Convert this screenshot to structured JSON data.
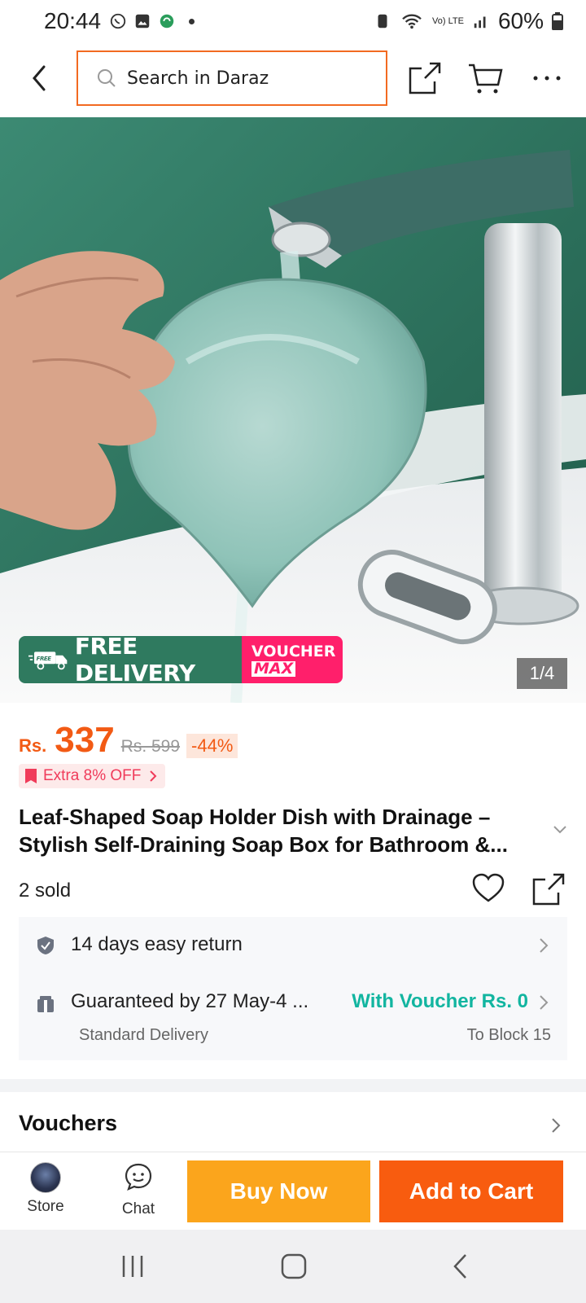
{
  "status_bar": {
    "time": "20:44",
    "battery": "60%",
    "network": "Vo) LTE"
  },
  "top_bar": {
    "search_placeholder": "Search in Daraz"
  },
  "gallery": {
    "pager": "1/4",
    "badge_free_delivery": "FREE DELIVERY",
    "badge_free_tag": "FREE",
    "badge_voucher": "VOUCHER",
    "badge_max": "MAX"
  },
  "product": {
    "currency": "Rs.",
    "price": "337",
    "original_price": "Rs. 599",
    "discount": "-44%",
    "extra_offer": "Extra 8% OFF",
    "title": "Leaf-Shaped Soap Holder Dish with Drainage – Stylish Self-Draining Soap Box for Bathroom &...",
    "sold": "2 sold"
  },
  "info": {
    "returns": "14 days easy return",
    "delivery_guarantee": "Guaranteed by 27 May-4 ...",
    "delivery_voucher": "With Voucher Rs. 0",
    "delivery_type": "Standard Delivery",
    "delivery_location": "To Block 15"
  },
  "sections": {
    "vouchers": "Vouchers"
  },
  "action_bar": {
    "store": "Store",
    "chat": "Chat",
    "buy_now": "Buy Now",
    "add_to_cart": "Add to Cart"
  },
  "colors": {
    "accent_orange": "#f25a14",
    "buy_now": "#fba51c",
    "add_to_cart": "#f85c0f",
    "delivery_green": "#12b5a0"
  }
}
